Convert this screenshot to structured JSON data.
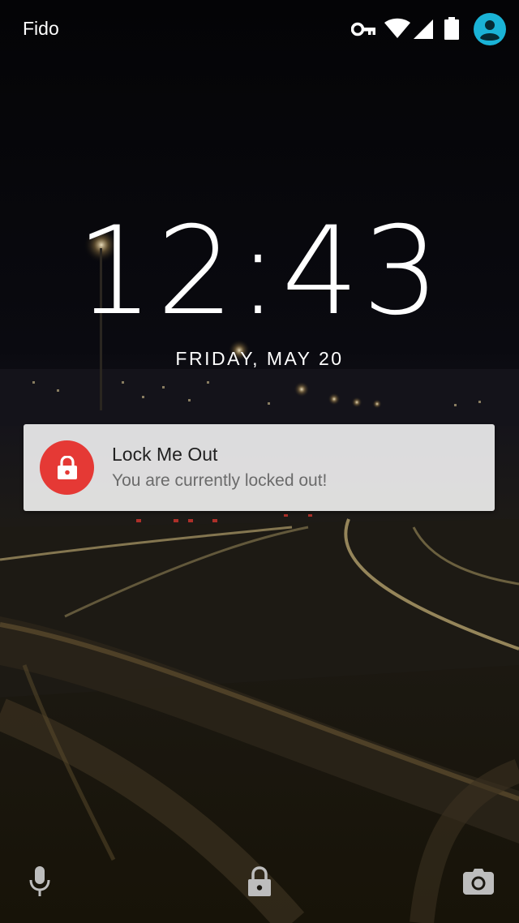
{
  "status_bar": {
    "carrier": "Fido",
    "icons": [
      "vpn-key-icon",
      "wifi-icon",
      "cell-signal-icon",
      "battery-icon",
      "user-avatar-icon"
    ],
    "avatar_color": "#1ab3d6"
  },
  "lockscreen": {
    "time": "12:43",
    "date": "FRIDAY, MAY 20"
  },
  "notification": {
    "title": "Lock Me Out",
    "text": "You are currently locked out!",
    "icon": "lock-icon",
    "icon_color": "#e53935"
  },
  "bottom_bar": {
    "left_icon": "microphone-icon",
    "center_icon": "lock-icon",
    "right_icon": "camera-icon"
  }
}
